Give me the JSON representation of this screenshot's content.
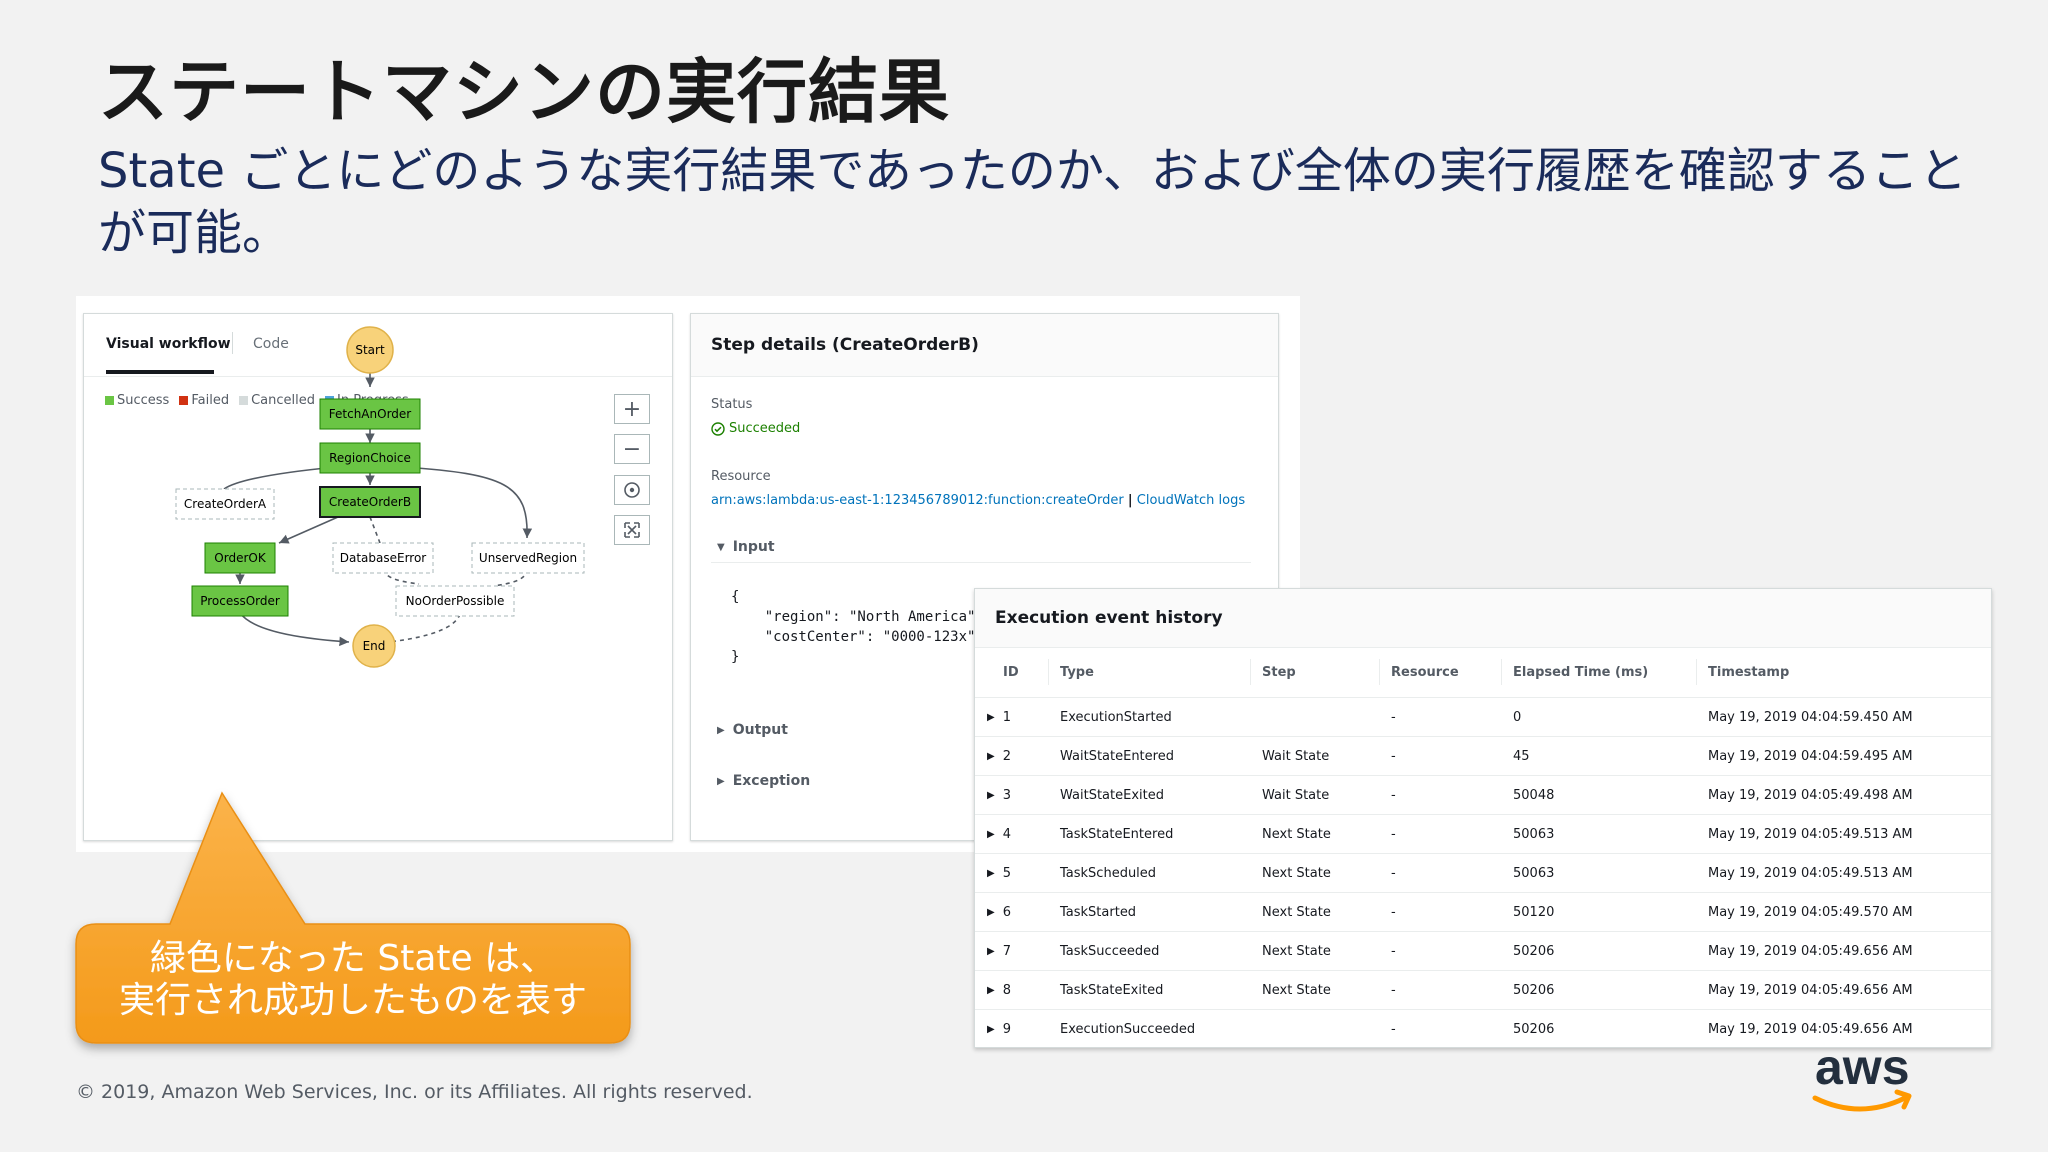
{
  "slide": {
    "title": "ステートマシンの実行結果",
    "subtitle": "State ごとにどのような実行結果であったのか、および全体の実行履歴を確認することが可能。",
    "callout_line1": "緑色になった State は、",
    "callout_line2": "実行され成功したものを表す",
    "footer": "© 2019, Amazon Web Services, Inc. or its Affiliates. All rights reserved.",
    "logo_text": "aws"
  },
  "workflow": {
    "tabs": [
      "Visual workflow",
      "Code"
    ],
    "legend": [
      {
        "label": "Success",
        "color": "#6ac544"
      },
      {
        "label": "Failed",
        "color": "#d13212"
      },
      {
        "label": "Cancelled",
        "color": "#d5dbdb"
      },
      {
        "label": "In Progress",
        "color": "#4fa3db"
      }
    ],
    "zoom_controls": [
      "+",
      "−",
      "center-icon",
      "fit-icon"
    ],
    "nodes": {
      "start": "Start",
      "fetch": "FetchAnOrder",
      "region": "RegionChoice",
      "create_a": "CreateOrderA",
      "create_b": "CreateOrderB",
      "order_ok": "OrderOK",
      "db_error": "DatabaseError",
      "unserved": "UnservedRegion",
      "process": "ProcessOrder",
      "no_order": "NoOrderPossible",
      "end": "End"
    },
    "colors": {
      "success": "#6ac544",
      "success_border": "#1d8102",
      "start_end": "#f8d27a",
      "start_end_border": "#e0b24a"
    }
  },
  "step_details": {
    "title": "Step details (CreateOrderB)",
    "status_label": "Status",
    "status_value": "Succeeded",
    "resource_label": "Resource",
    "resource_arn": "arn:aws:lambda:us-east-1:123456789012:function:createOrder",
    "resource_sep": "|",
    "resource_logs": "CloudWatch logs",
    "input_label": "Input",
    "input_code": "{\n    \"region\": \"North America\",\n    \"costCenter\": \"0000-123x\"\n}",
    "output_label": "Output",
    "exception_label": "Exception"
  },
  "history": {
    "title": "Execution event history",
    "columns": [
      "ID",
      "Type",
      "Step",
      "Resource",
      "Elapsed Time (ms)",
      "Timestamp"
    ],
    "rows": [
      [
        "1",
        "ExecutionStarted",
        "",
        "-",
        "0",
        "May 19, 2019 04:04:59.450 AM"
      ],
      [
        "2",
        "WaitStateEntered",
        "Wait State",
        "-",
        "45",
        "May 19, 2019 04:04:59.495 AM"
      ],
      [
        "3",
        "WaitStateExited",
        "Wait State",
        "-",
        "50048",
        "May 19, 2019 04:05:49.498 AM"
      ],
      [
        "4",
        "TaskStateEntered",
        "Next State",
        "-",
        "50063",
        "May 19, 2019 04:05:49.513 AM"
      ],
      [
        "5",
        "TaskScheduled",
        "Next State",
        "-",
        "50063",
        "May 19, 2019 04:05:49.513 AM"
      ],
      [
        "6",
        "TaskStarted",
        "Next State",
        "-",
        "50120",
        "May 19, 2019 04:05:49.570 AM"
      ],
      [
        "7",
        "TaskSucceeded",
        "Next State",
        "-",
        "50206",
        "May 19, 2019 04:05:49.656 AM"
      ],
      [
        "8",
        "TaskStateExited",
        "Next State",
        "-",
        "50206",
        "May 19, 2019 04:05:49.656 AM"
      ],
      [
        "9",
        "ExecutionSucceeded",
        "",
        "-",
        "50206",
        "May 19, 2019 04:05:49.656 AM"
      ]
    ]
  }
}
